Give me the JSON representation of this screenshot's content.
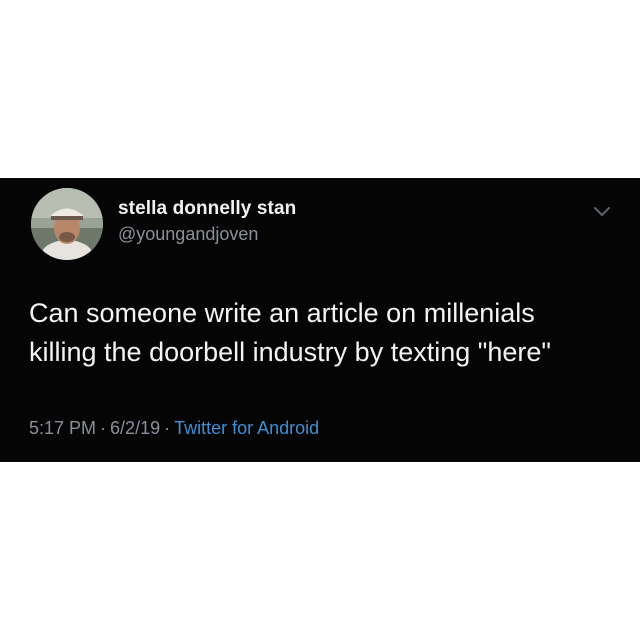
{
  "tweet": {
    "display_name": "stella donnelly stan",
    "handle": "@youngandjoven",
    "text": "Can someone write an article on millenials\nkilling the doorbell industry by texting \"here\"",
    "time": "5:17 PM",
    "date": "6/2/19",
    "separator": "·",
    "source": "Twitter for Android",
    "avatar_icon": "profile-photo",
    "menu_icon": "chevron-down-icon"
  },
  "colors": {
    "background": "#050505",
    "text": "#f4f4f4",
    "muted": "#8a9099",
    "link": "#3d8fd6"
  }
}
